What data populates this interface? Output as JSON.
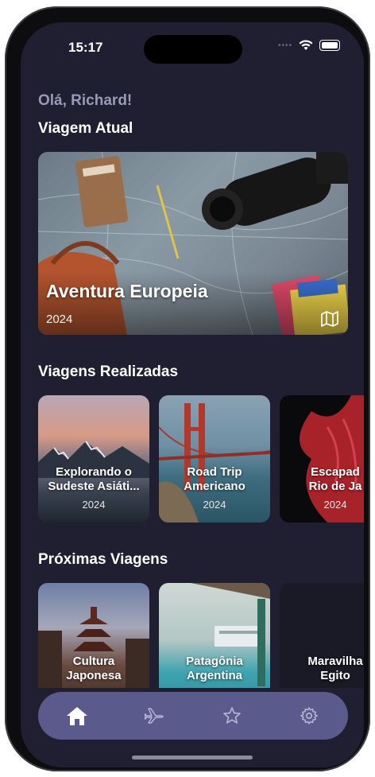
{
  "status": {
    "time": "15:17"
  },
  "greeting": "Olá, Richard!",
  "current": {
    "section_title": "Viagem Atual",
    "trip": {
      "title": "Aventura Europeia",
      "year": "2024",
      "icon": "map-icon"
    }
  },
  "done": {
    "section_title": "Viagens Realizadas",
    "trips": [
      {
        "title_line1": "Explorando o",
        "title_line2": "Sudeste Asiáti...",
        "year": "2024"
      },
      {
        "title_line1": "Road Trip",
        "title_line2": "Americano",
        "year": "2024"
      },
      {
        "title_line1": "Escapad",
        "title_line2": "Rio de Ja",
        "year": "2024"
      }
    ]
  },
  "upcoming": {
    "section_title": "Próximas Viagens",
    "trips": [
      {
        "title_line1": "Cultura",
        "title_line2": "Japonesa"
      },
      {
        "title_line1": "Patagônia",
        "title_line2": "Argentina"
      },
      {
        "title_line1": "Maravilha",
        "title_line2": "Egito"
      }
    ]
  },
  "nav": {
    "items": [
      {
        "icon": "home-icon",
        "active": true
      },
      {
        "icon": "airplane-icon",
        "active": false
      },
      {
        "icon": "star-icon",
        "active": false
      },
      {
        "icon": "gear-icon",
        "active": false
      }
    ]
  },
  "colors": {
    "background": "#1f1f31",
    "nav": "#5b5a8c",
    "accent_text": "#9a9ab8"
  }
}
